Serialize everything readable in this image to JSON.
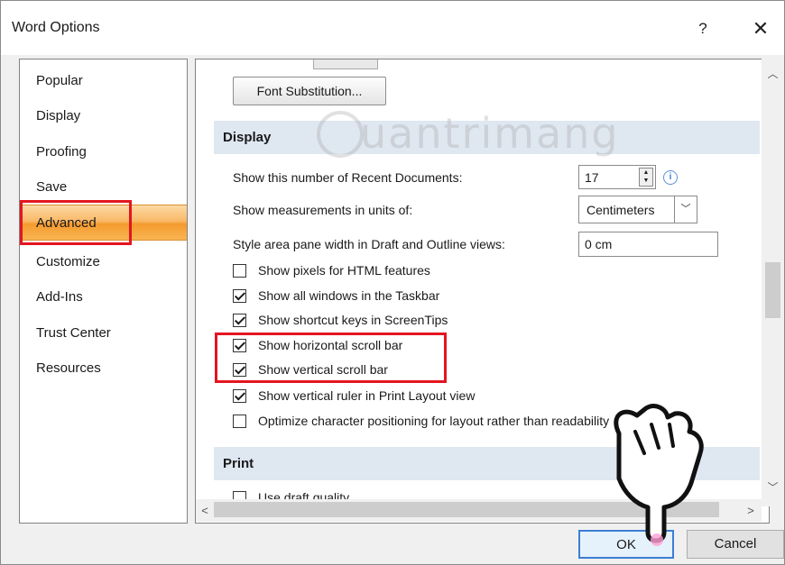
{
  "window": {
    "title": "Word Options",
    "help_label": "?",
    "close_label": "✕"
  },
  "sidebar": {
    "items": [
      {
        "label": "Popular",
        "selected": false
      },
      {
        "label": "Display",
        "selected": false
      },
      {
        "label": "Proofing",
        "selected": false
      },
      {
        "label": "Save",
        "selected": false
      },
      {
        "label": "Advanced",
        "selected": true
      },
      {
        "label": "Customize",
        "selected": false
      },
      {
        "label": "Add-Ins",
        "selected": false
      },
      {
        "label": "Trust Center",
        "selected": false
      },
      {
        "label": "Resources",
        "selected": false
      }
    ]
  },
  "content": {
    "font_substitution_label": "Font Substitution...",
    "display_section": {
      "heading": "Display",
      "recent_docs_label": "Show this number of Recent Documents:",
      "recent_docs_value": "17",
      "units_label": "Show measurements in units of:",
      "units_value": "Centimeters",
      "style_area_label": "Style area pane width in Draft and Outline views:",
      "style_area_value": "0 cm",
      "checkboxes": [
        {
          "label": "Show pixels for HTML features",
          "checked": false
        },
        {
          "label": "Show all windows in the Taskbar",
          "checked": true
        },
        {
          "label": "Show shortcut keys in ScreenTips",
          "checked": true
        },
        {
          "label": "Show horizontal scroll bar",
          "checked": true
        },
        {
          "label": "Show vertical scroll bar",
          "checked": true
        },
        {
          "label": "Show vertical ruler in Print Layout view",
          "checked": true
        },
        {
          "label": "Optimize character positioning for layout rather than readability",
          "checked": false
        }
      ]
    },
    "print_section": {
      "heading": "Print",
      "partial_label": "Use draft quality"
    }
  },
  "footer": {
    "ok_label": "OK",
    "cancel_label": "Cancel"
  },
  "watermark": {
    "text": "uantrimang"
  },
  "colors": {
    "highlight_red": "#e3151f",
    "selected_orange": "#f59b2e",
    "section_header_bg": "#dfe7f1",
    "ok_border": "#3b7fd4"
  }
}
